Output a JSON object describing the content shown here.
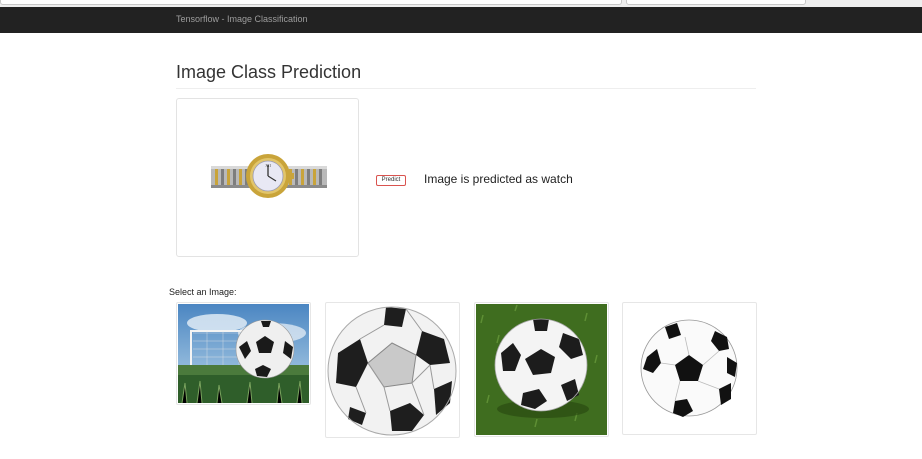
{
  "navbar": {
    "brand": "Tensorflow - Image Classification"
  },
  "page": {
    "title": "Image Class Prediction"
  },
  "prediction": {
    "button_label": "Predict",
    "result_text": "Image is predicted as watch",
    "preview_subject": "watch"
  },
  "gallery": {
    "label": "Select an Image:",
    "images": [
      {
        "subject": "soccer ball in goal on grass"
      },
      {
        "subject": "soccer ball"
      },
      {
        "subject": "soccer ball on grass"
      },
      {
        "subject": "soccer ball"
      }
    ]
  },
  "colors": {
    "navbar_bg": "#222222",
    "brand_text": "#9d9d9d",
    "predict_border": "#d9534f"
  }
}
